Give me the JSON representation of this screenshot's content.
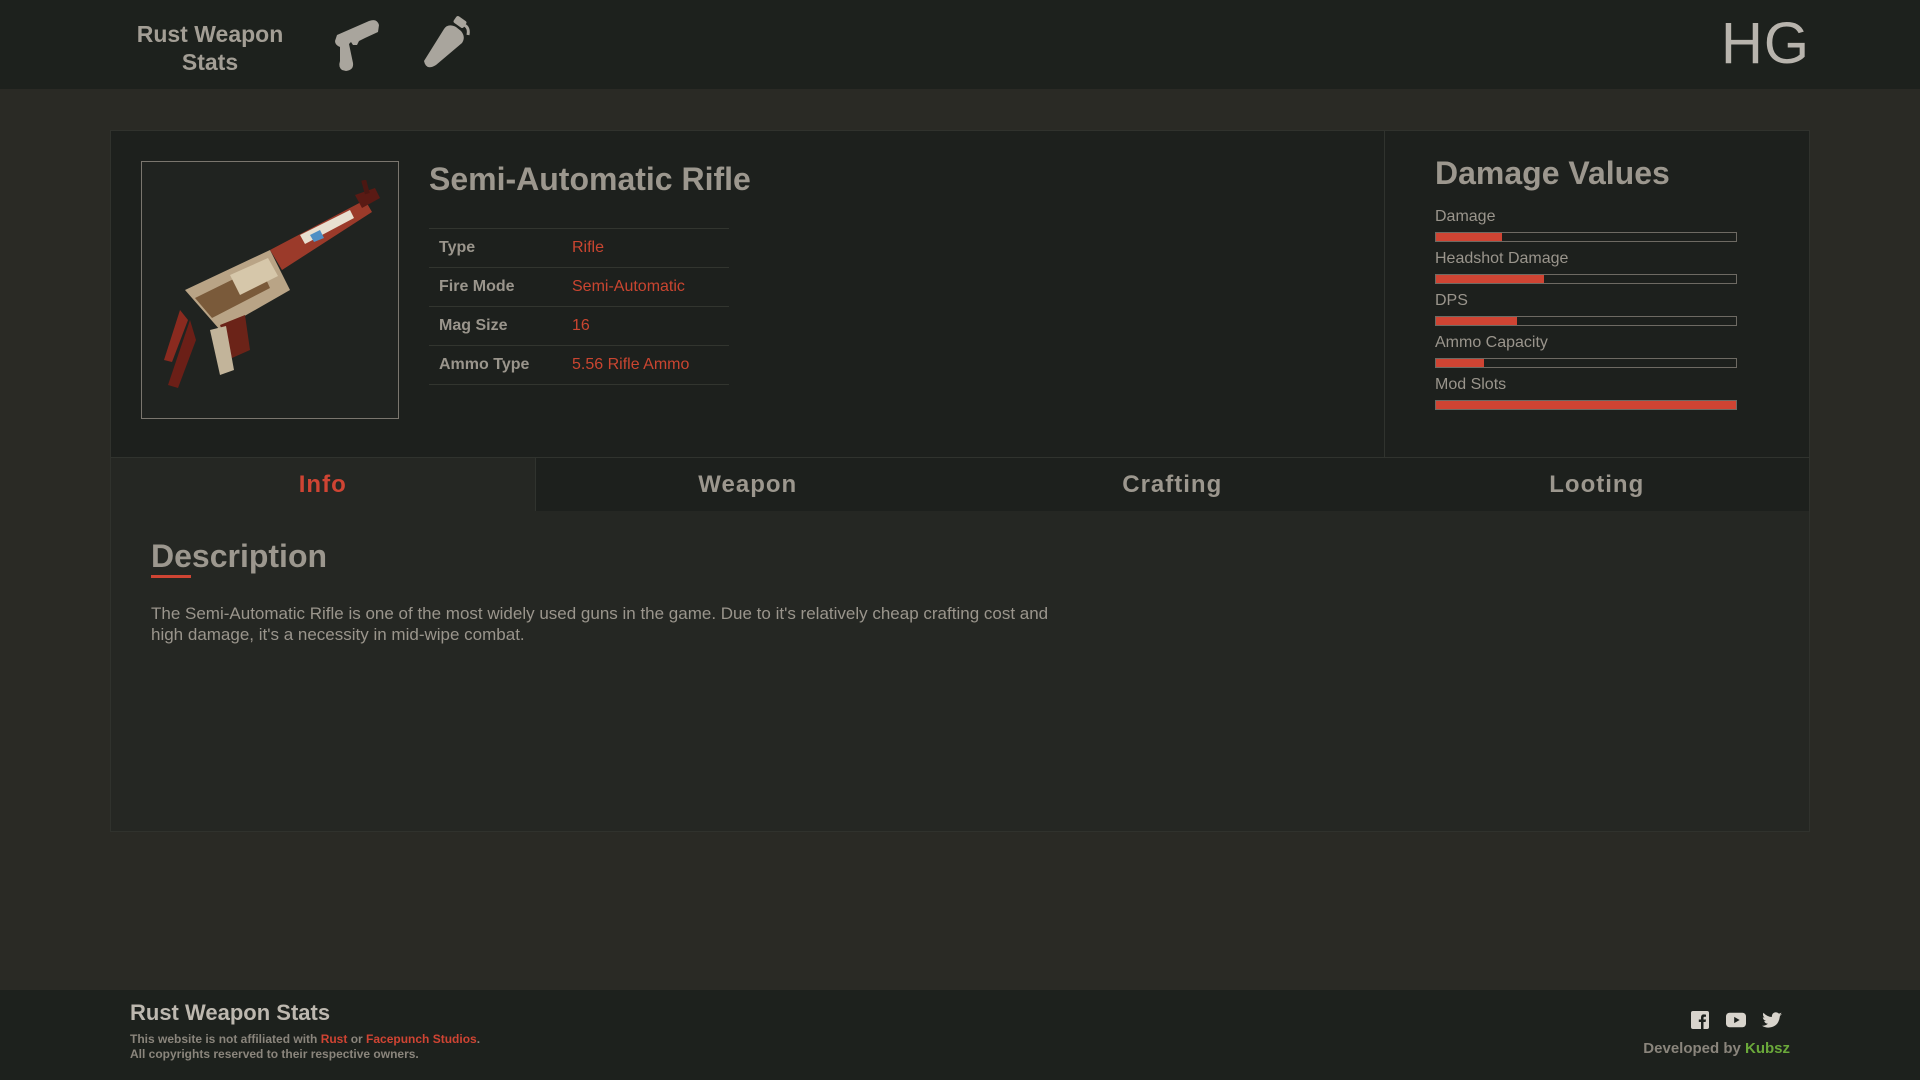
{
  "header": {
    "brand": "Rust Weapon Stats",
    "nav_icons": [
      "pistol-icon",
      "grenade-icon"
    ],
    "logo": "HG"
  },
  "weapon": {
    "name": "Semi-Automatic Rifle",
    "image_icon": "semi-automatic-rifle-image",
    "stats": [
      {
        "label": "Type",
        "value": "Rifle"
      },
      {
        "label": "Fire Mode",
        "value": "Semi-Automatic"
      },
      {
        "label": "Mag Size",
        "value": "16"
      },
      {
        "label": "Ammo Type",
        "value": "5.56 Rifle Ammo"
      }
    ]
  },
  "damage": {
    "title": "Damage Values",
    "bars": [
      {
        "label": "Damage",
        "fill": 0.22
      },
      {
        "label": "Headshot Damage",
        "fill": 0.36
      },
      {
        "label": "DPS",
        "fill": 0.27
      },
      {
        "label": "Ammo Capacity",
        "fill": 0.16
      },
      {
        "label": "Mod Slots",
        "fill": 1.0
      }
    ]
  },
  "tabs": [
    {
      "label": "Info",
      "active": true
    },
    {
      "label": "Weapon",
      "active": false
    },
    {
      "label": "Crafting",
      "active": false
    },
    {
      "label": "Looting",
      "active": false
    }
  ],
  "description": {
    "title": "Description",
    "text": "The Semi-Automatic Rifle is one of the most widely used guns in the game. Due to it's relatively cheap crafting cost and high damage, it's a necessity in mid-wipe combat."
  },
  "footer": {
    "brand": "Rust Weapon Stats",
    "note_prefix": "This website is not affiliated with ",
    "note_rust": "Rust",
    "note_or": " or ",
    "note_facepunch": "Facepunch Studios",
    "note_period": ".",
    "note_line2": "All copyrights reserved to their respective owners.",
    "socials": [
      "facebook-icon",
      "youtube-icon",
      "twitter-icon"
    ],
    "dev_prefix": "Developed by ",
    "dev_name": "Kubsz"
  },
  "colors": {
    "accent": "#cf4433",
    "dev_name": "#6aa83a",
    "header_bg": "#1d211d",
    "page_bg": "#2a2a25"
  }
}
